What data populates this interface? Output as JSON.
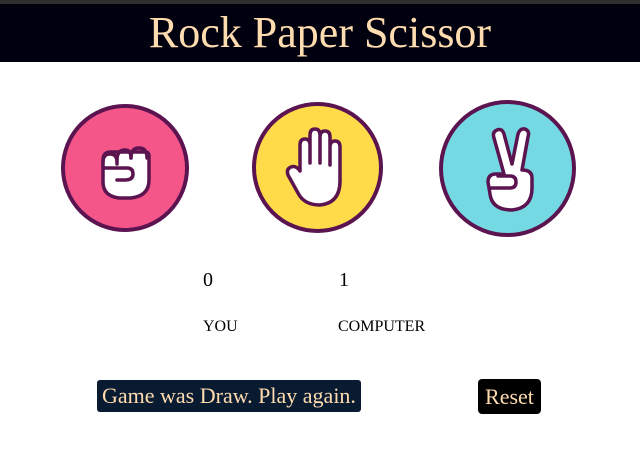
{
  "header": {
    "title": "Rock Paper Scissor"
  },
  "choices": [
    {
      "id": "rock",
      "icon": "fist-icon",
      "color": "#f4568a"
    },
    {
      "id": "paper",
      "icon": "open-hand-icon",
      "color": "#ffdb4a"
    },
    {
      "id": "scissor",
      "icon": "victory-hand-icon",
      "color": "#74d9e3"
    }
  ],
  "score": {
    "user": "0",
    "computer": "1",
    "user_label": "YOU",
    "computer_label": "COMPUTER"
  },
  "message": "Game was Draw. Play again.",
  "reset_label": "Reset",
  "colors": {
    "header_bg": "#00000f",
    "header_text": "#ffdcb0",
    "outline": "#5b1450",
    "message_bg": "#081b31"
  }
}
